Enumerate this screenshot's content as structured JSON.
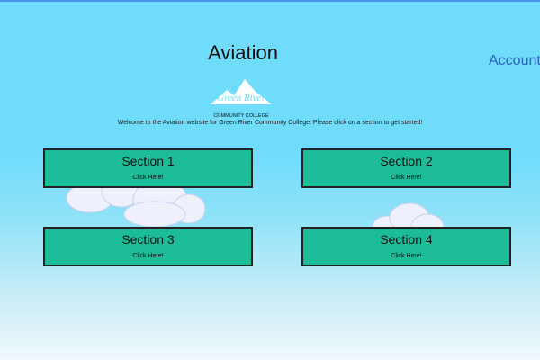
{
  "page": {
    "title": "Aviation",
    "account_menu": "Account-",
    "welcome_text": "Welcome to the Aviation website for Green River Community College. Please click on a section to get started!"
  },
  "logo": {
    "line1": "Green River",
    "line2": "COMMUNITY COLLEGE"
  },
  "sections": [
    {
      "name": "Section 1",
      "link": "Click Here!"
    },
    {
      "name": "Section 2",
      "link": "Click Here!"
    },
    {
      "name": "Section 3",
      "link": "Click Here!"
    },
    {
      "name": "Section 4",
      "link": "Click Here!"
    }
  ],
  "colors": {
    "sky": "#6fdcfc",
    "section_fill": "#1dbc99",
    "section_border": "#222222",
    "account_link": "#2f62c0"
  }
}
